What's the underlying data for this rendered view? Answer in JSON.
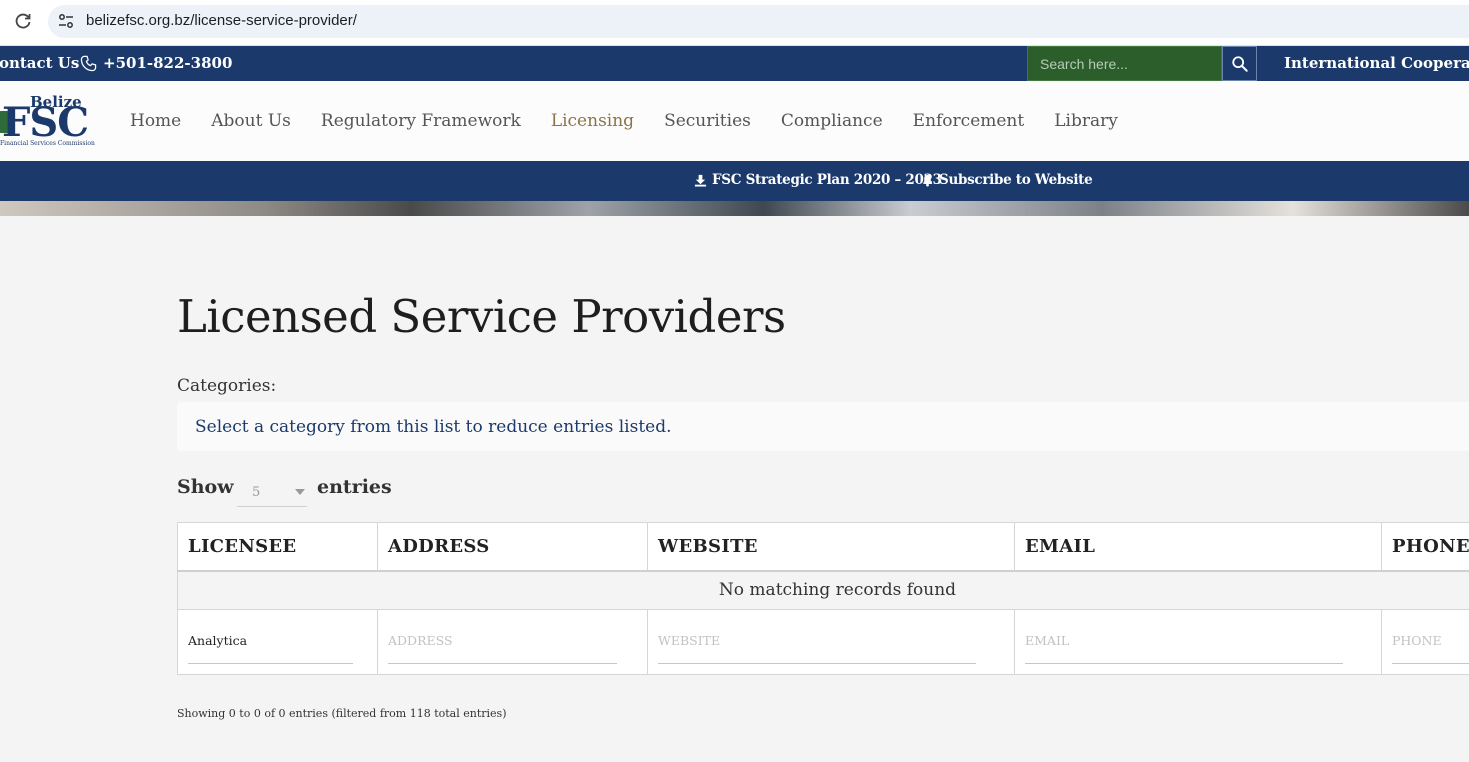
{
  "browser": {
    "url": "belizefsc.org.bz/license-service-provider/"
  },
  "topbar": {
    "contact_label": "Contact Us",
    "phone": "+501-822-3800",
    "search_placeholder": "Search here...",
    "intl_label": "International Cooperation"
  },
  "header": {
    "logo": {
      "top": "Belize",
      "main": "FSC",
      "sub": "Financial Services Commission"
    },
    "nav": [
      {
        "label": "Home"
      },
      {
        "label": "About Us"
      },
      {
        "label": "Regulatory Framework"
      },
      {
        "label": "Licensing",
        "active": true
      },
      {
        "label": "Securities"
      },
      {
        "label": "Compliance"
      },
      {
        "label": "Enforcement"
      },
      {
        "label": "Library"
      }
    ]
  },
  "subbar": {
    "plan_label": "FSC Strategic Plan 2020 – 2023",
    "subscribe_label": "Subscribe to Website"
  },
  "content": {
    "title": "Licensed Service Providers",
    "categories_label": "Categories:",
    "category_placeholder": "Select a category from this list to reduce entries listed.",
    "show_label": "Show",
    "entries_value": "5",
    "entries_label": "entries",
    "table": {
      "columns": [
        "LICENSEE",
        "ADDRESS",
        "WEBSITE",
        "EMAIL",
        "PHONE"
      ],
      "empty_message": "No matching records found",
      "filters": [
        {
          "value": "Analytica",
          "placeholder": ""
        },
        {
          "value": "",
          "placeholder": "ADDRESS"
        },
        {
          "value": "",
          "placeholder": "WEBSITE"
        },
        {
          "value": "",
          "placeholder": "EMAIL"
        },
        {
          "value": "",
          "placeholder": "PHONE"
        }
      ]
    },
    "info": "Showing 0 to 0 of 0 entries (filtered from 118 total entries)"
  },
  "colors": {
    "navy": "#1b3a6b",
    "search_green": "#2b5e2a",
    "nav_active": "#8c7447",
    "page_bg": "#f4f4f4"
  }
}
